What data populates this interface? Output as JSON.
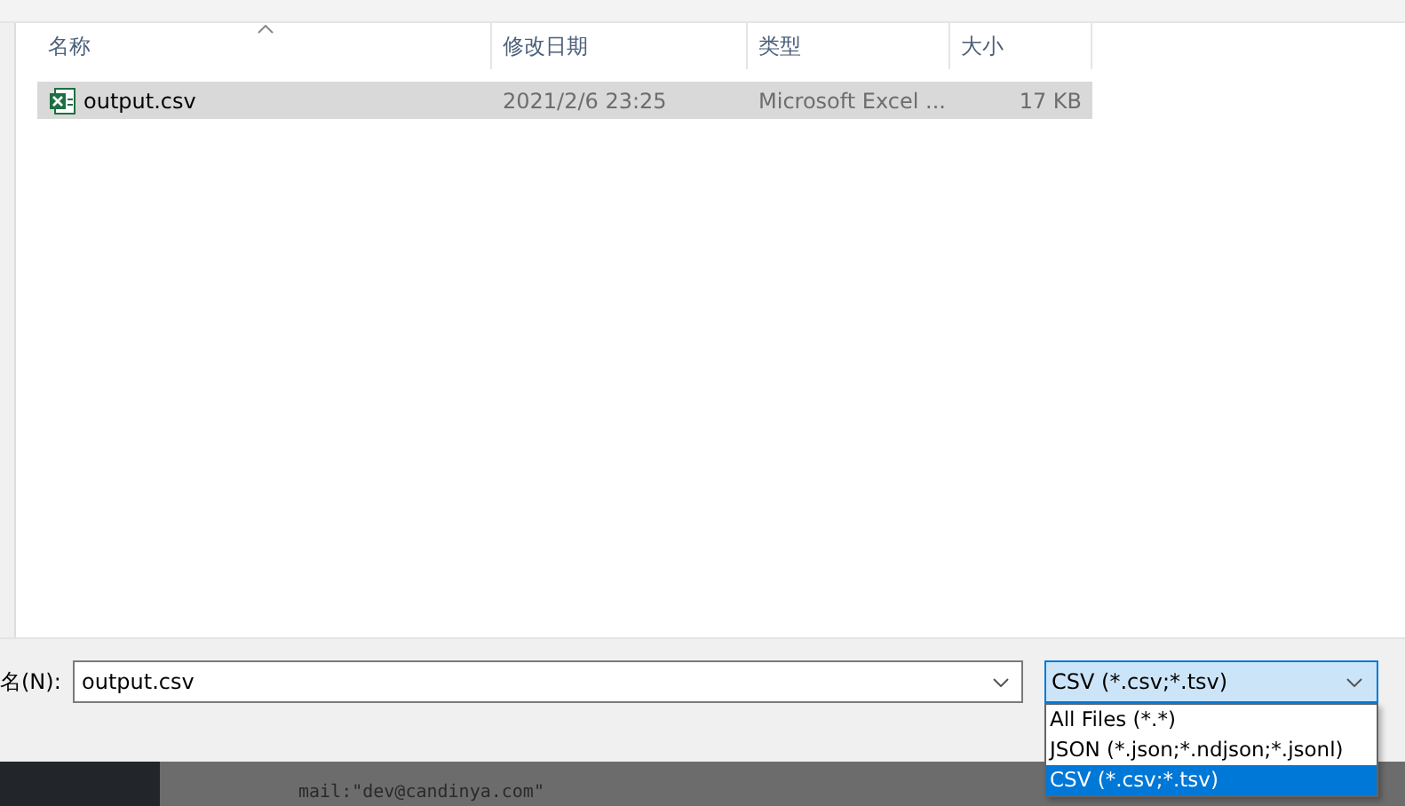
{
  "file_list": {
    "columns": [
      {
        "label": "名称",
        "sorted": true
      },
      {
        "label": "修改日期",
        "sorted": false
      },
      {
        "label": "类型",
        "sorted": false
      },
      {
        "label": "大小",
        "sorted": false
      }
    ],
    "rows": [
      {
        "name": "output.csv",
        "modified": "2021/2/6 23:25",
        "type": "Microsoft Excel ...",
        "size": "17 KB",
        "selected": true
      }
    ]
  },
  "filename": {
    "label": "名(N):",
    "value": "output.csv"
  },
  "file_type": {
    "value": "CSV (*.csv;*.tsv)",
    "expanded": true,
    "options": [
      {
        "label": "All Files (*.*)",
        "selected": false
      },
      {
        "label": "JSON (*.json;*.ndjson;*.jsonl)",
        "selected": false
      },
      {
        "label": "CSV (*.csv;*.tsv)",
        "selected": true
      }
    ]
  },
  "background_code": {
    "line": "mail:\"dev@candinya.com\""
  }
}
